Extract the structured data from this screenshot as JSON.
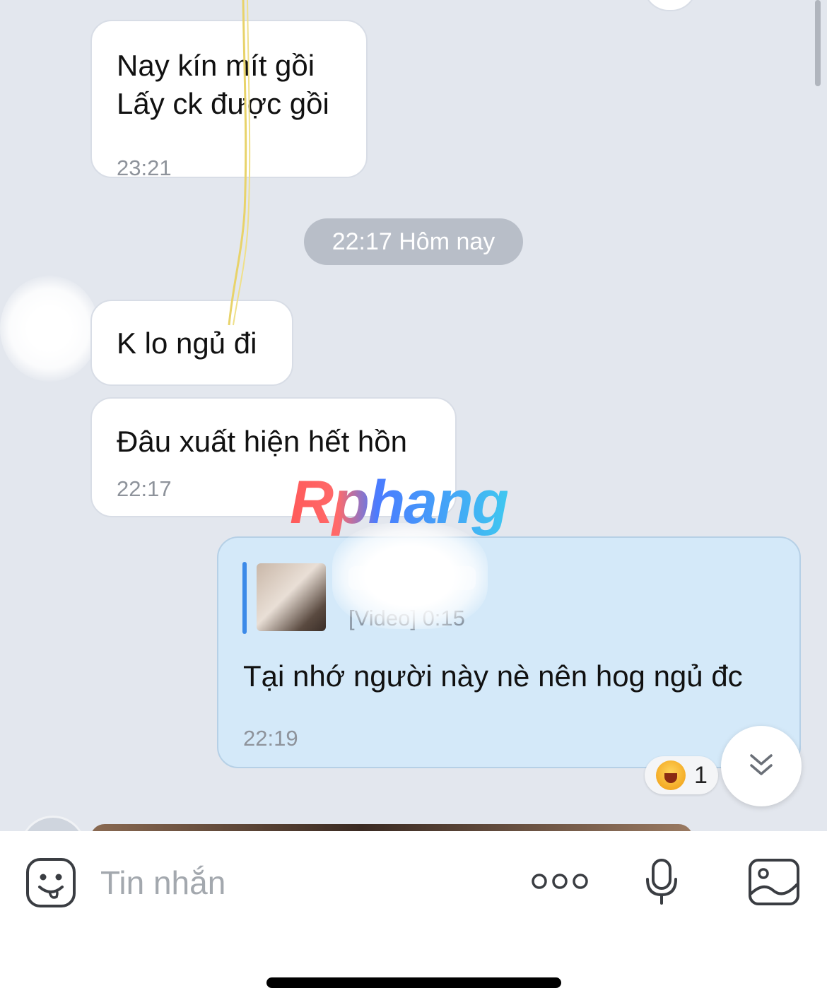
{
  "messages": {
    "m1": {
      "text": "Nay kín mít gồi\nLấy ck được gồi",
      "time": "23:21"
    },
    "date_separator": "22:17 Hôm nay",
    "m2": {
      "text": "K lo ngủ đi"
    },
    "m3": {
      "text": "Đâu xuất hiện hết hồn",
      "time": "22:17"
    },
    "m4": {
      "quote_meta": "[Video] 0:15",
      "text": "Tại nhớ người này nè nên hog ngủ đc",
      "time": "22:19",
      "reaction": {
        "icon": "laughing-face-icon",
        "count": "1"
      }
    }
  },
  "watermark": "Rphang",
  "input": {
    "placeholder": "Tin nhắn",
    "icons": [
      "emoji-sticker-icon",
      "more-dots-icon",
      "microphone-icon",
      "image-icon"
    ]
  },
  "colors": {
    "chat_background": "#e3e7ee",
    "incoming_bubble": "#ffffff",
    "outgoing_bubble": "#d4e9f9",
    "quote_bar": "#3c8ae8"
  }
}
